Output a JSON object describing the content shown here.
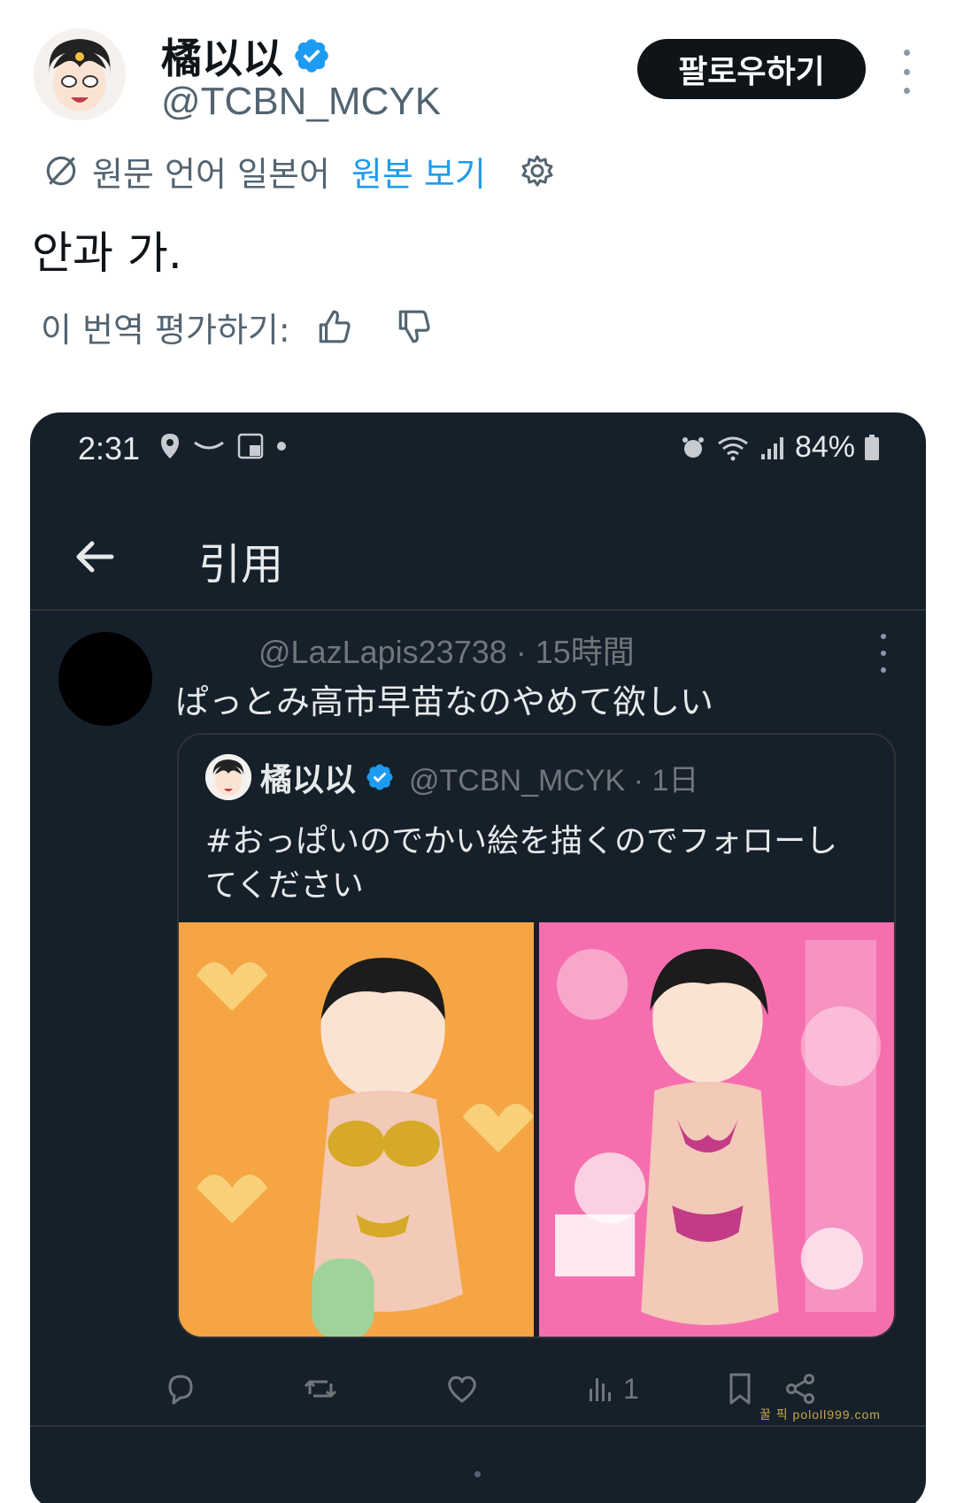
{
  "author": {
    "name": "橘以以",
    "handle": "@TCBN_MCYK",
    "follow_label": "팔로우하기"
  },
  "translation": {
    "source_label": "원문 언어 일본어",
    "show_original_label": "원본 보기",
    "translated_text": "안과 가.",
    "rate_label": "이 번역 평가하기:"
  },
  "phone": {
    "status": {
      "time": "2:31",
      "battery": "84%"
    },
    "header_title": "引用",
    "quote_tweet": {
      "meta": "@LazLapis23738 · 15時間",
      "text": "ぱっとみ高市早苗なのやめて欲しい"
    },
    "embedded": {
      "name": "橘以以",
      "meta": "@TCBN_MCYK · 1日",
      "text": "#おっぱいのでかい絵を描くのでフォローしてください"
    },
    "actions": {
      "views_count": "1"
    }
  },
  "watermark": "꿀 픽 pololl999.com",
  "colors": {
    "accent": "#1d9bf0",
    "dark_bg": "#15202b",
    "muted": "#536471"
  }
}
